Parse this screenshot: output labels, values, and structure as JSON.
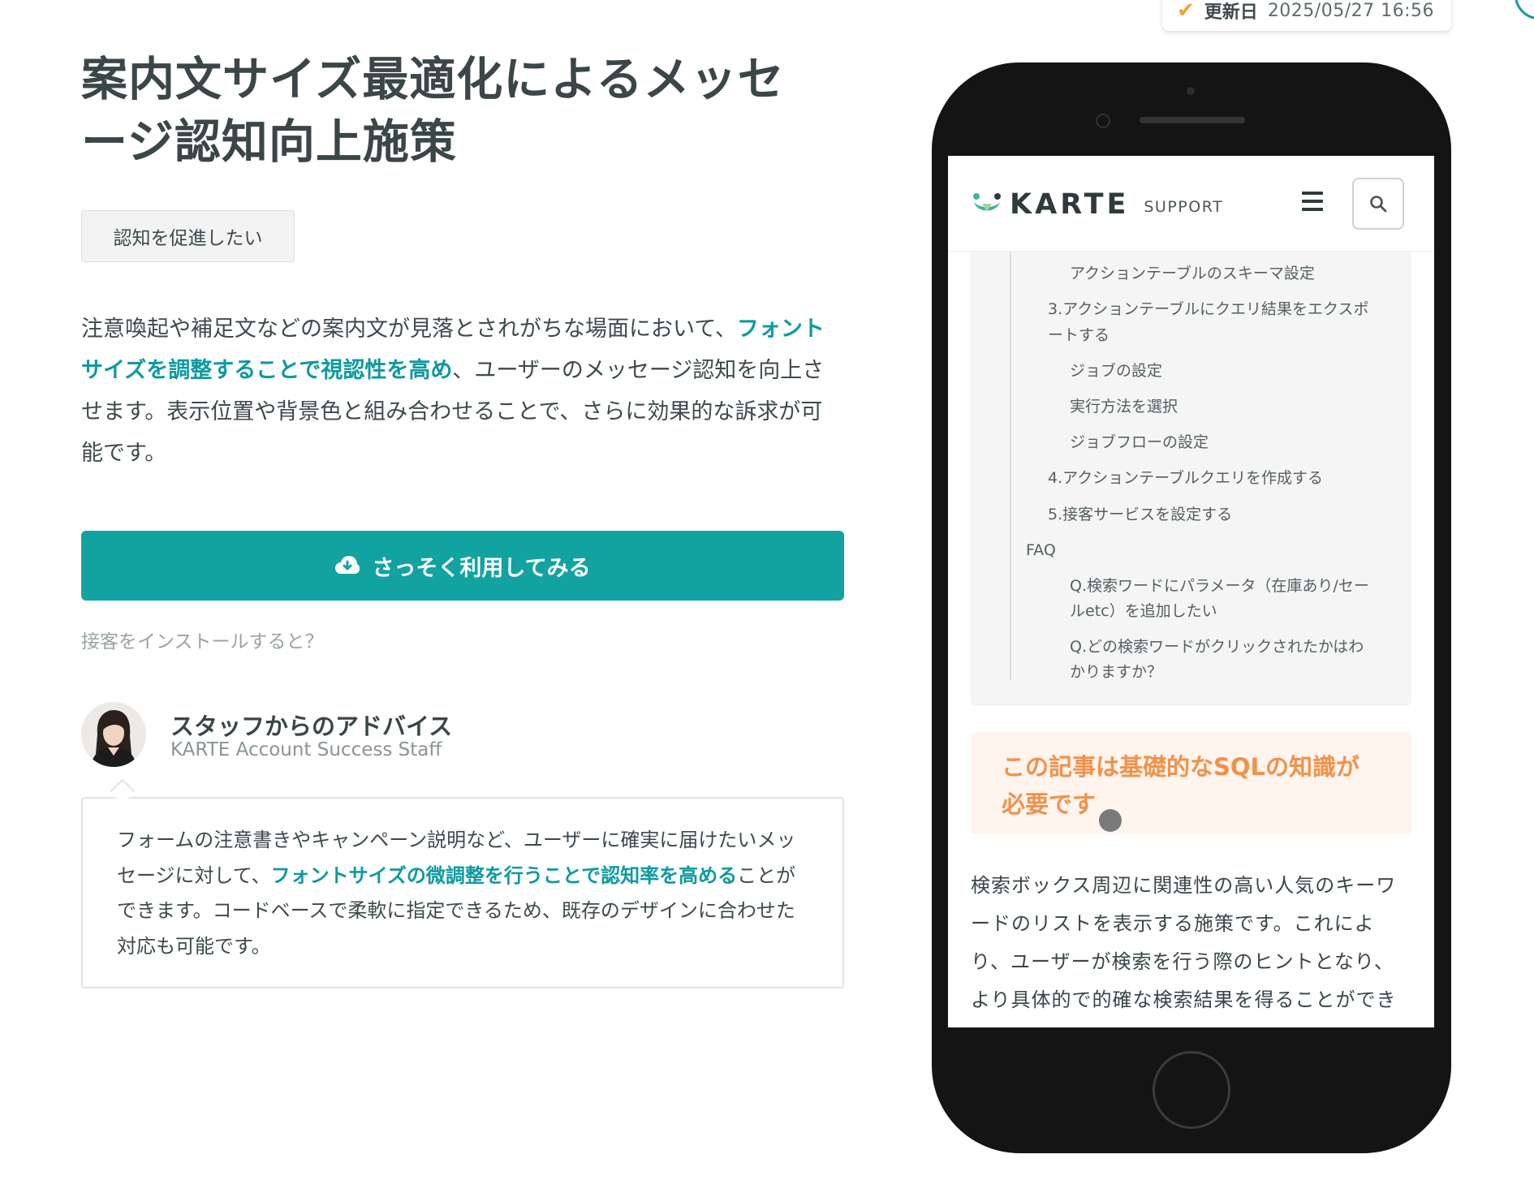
{
  "update": {
    "label": "更新日",
    "value": "2025/05/27  16:56"
  },
  "title": "案内文サイズ最適化によるメッセージ認知向上施策",
  "tag": "認知を促進したい",
  "description": {
    "part1": "注意喚起や補足文などの案内文が見落とされがちな場面において、",
    "highlight": "フォントサイズを調整することで視認性を高め",
    "part2": "、ユーザーのメッセージ認知を向上させます。表示位置や背景色と組み合わせることで、さらに効果的な訴求が可能です。"
  },
  "cta": {
    "label": "さっそく利用してみる",
    "icon": "cloud-download-icon"
  },
  "install_link": "接客をインストールすると？",
  "staff": {
    "title": "スタッフからのアドバイス",
    "role": "KARTE Account Success Staff"
  },
  "advice": {
    "part1": "フォームの注意書きやキャンペーン説明など、ユーザーに確実に届けたいメッセージに対して、",
    "highlight": "フォントサイズの微調整を行うことで認知率を高める",
    "part2": "ことができます。コードベースで柔軟に指定できるため、既存のデザインに合わせた対応も可能です。"
  },
  "phone_screen": {
    "brand": "KARTE",
    "brand_sub": "SUPPORT",
    "toc": [
      "アクションテーブルのスキーマ設定",
      "3.アクションテーブルにクエリ結果をエクスポ",
      "ートする",
      "ジョブの設定",
      "実行方法を選択",
      "ジョブフローの設定",
      "4.アクションテーブルクエリを作成する",
      "5.接客サービスを設定する",
      "FAQ",
      "Q.検索ワードにパラメータ（在庫あり/セー",
      "ルetc）を追加したい",
      "Q.どの検索ワードがクリックされたかはわ",
      "かりますか？"
    ],
    "notice": "この記事は基礎的なSQLの知識が必要です",
    "body": "検索ボックス周辺に関連性の高い人気のキーワードのリストを表示する施策です。これにより、ユーザーが検索を行う際のヒントとなり、より具体的で的確な検索結果を得ることができ"
  },
  "colors": {
    "accent": "#0f9aa0",
    "cta": "#12a3a1",
    "notice": "#f2914a",
    "check": "#f0a431"
  }
}
